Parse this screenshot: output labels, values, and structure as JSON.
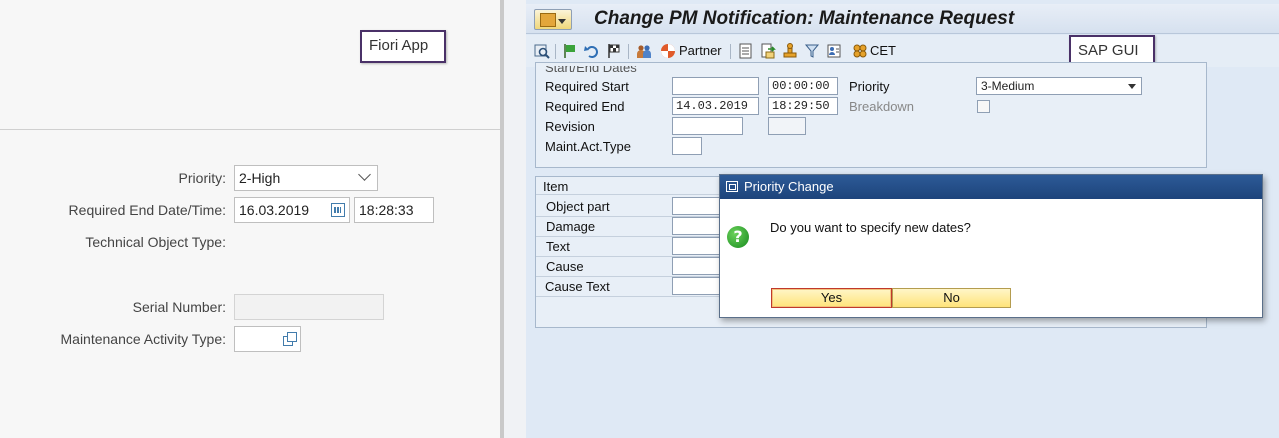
{
  "fiori": {
    "callout": "Fiori App",
    "form": {
      "priority": {
        "label": "Priority:",
        "value": "2-High"
      },
      "required_end": {
        "label": "Required End Date/Time:",
        "date": "16.03.2019",
        "time": "18:28:33"
      },
      "technical_object_type": {
        "label": "Technical Object Type:"
      },
      "serial_number": {
        "label": "Serial Number:",
        "value": ""
      },
      "maintenance_activity_type": {
        "label": "Maintenance Activity Type:",
        "value": ""
      }
    }
  },
  "sapgui": {
    "callout": "SAP GUI",
    "title": "Change PM Notification: Maintenance Request",
    "toolbar": {
      "partner_label": "Partner",
      "cet_label": "CET"
    },
    "dates_group": {
      "title": "Start/End Dates",
      "required_start": {
        "label": "Required Start",
        "date": "",
        "time": "00:00:00"
      },
      "required_end": {
        "label": "Required End",
        "date": "14.03.2019",
        "time": "18:29:50"
      },
      "revision": {
        "label": "Revision"
      },
      "maint_act_type": {
        "label": "Maint.Act.Type"
      },
      "priority": {
        "label": "Priority",
        "value": "3-Medium"
      },
      "breakdown": {
        "label": "Breakdown"
      }
    },
    "item_group": {
      "title": "Item",
      "rows": [
        "Object part",
        "Damage",
        "Text",
        "Cause",
        "Cause Text"
      ]
    },
    "dialog": {
      "title": "Priority Change",
      "message": "Do you want to specify new dates?",
      "yes_label": "Yes",
      "no_label": "No"
    }
  },
  "colors": {
    "title_bar": "#1d447b",
    "button_yellow": "#ffe47a",
    "callout_border": "#4a3168"
  }
}
